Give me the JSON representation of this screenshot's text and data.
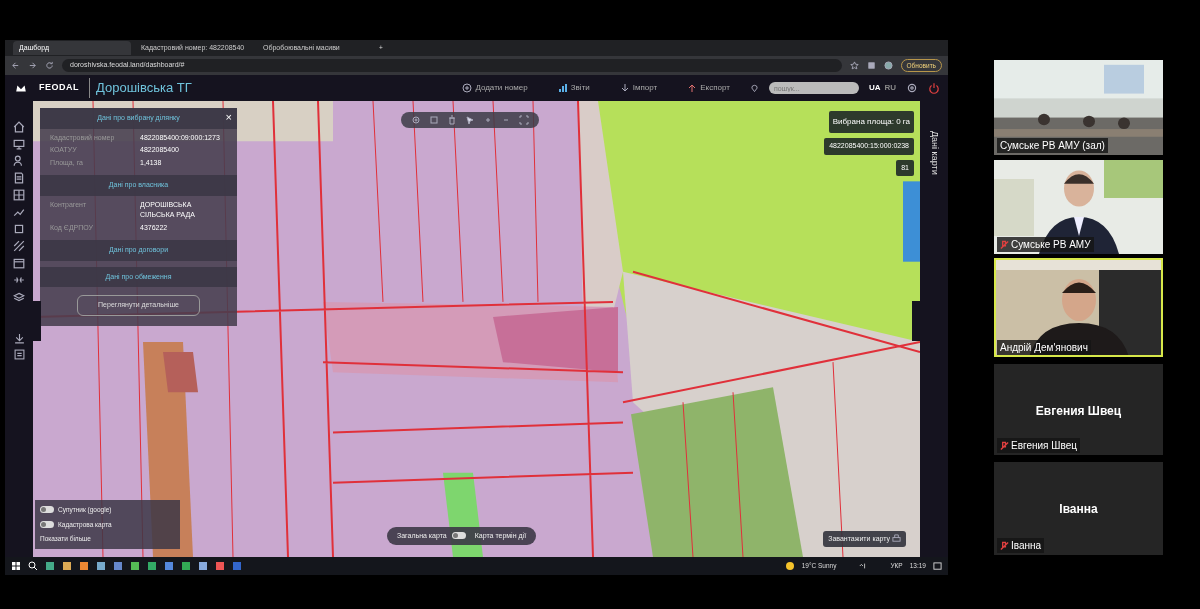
{
  "browser": {
    "tabs": [
      {
        "label": "Дашборд",
        "selected": true
      },
      {
        "label": "Кадастровий номер: 482208540",
        "selected": false
      },
      {
        "label": "Обробоювальні масиви",
        "selected": false
      }
    ],
    "new_tab": "+",
    "url": "doroshivska.feodal.land/dashboard/#",
    "update_button": "Обновить"
  },
  "app": {
    "brand": "FEODAL",
    "title": "Дорошівська ТГ",
    "actions": [
      {
        "label": "Додати номер"
      },
      {
        "label": "Звіти"
      },
      {
        "label": "Імпорт"
      },
      {
        "label": "Експорт"
      }
    ],
    "search_placeholder": "пошук...",
    "languages": [
      {
        "label": "UA",
        "selected": true
      },
      {
        "label": "RU",
        "selected": false
      }
    ]
  },
  "parcel_panel": {
    "title": "Дані про вибрану ділянку",
    "close": "×",
    "sections": [
      {
        "fields": [
          {
            "label": "Кадастровий номер",
            "value": "4822085400:09:000:1273"
          },
          {
            "label": "КОАТУУ",
            "value": "4822085400"
          },
          {
            "label": "Площа, га",
            "value": "1,4138"
          }
        ]
      },
      {
        "title": "Дані про власника",
        "fields": [
          {
            "label": "Контрагент",
            "value": "ДОРОШІВСЬКА СІЛЬСЬКА РАДА"
          },
          {
            "label": "Код ЄДРПОУ",
            "value": "4376222"
          }
        ]
      },
      {
        "title": "Дані про договори"
      },
      {
        "title": "Дані про обмеження"
      }
    ],
    "button": "Переглянути детальніше"
  },
  "selection_info": {
    "area": "Вибрана площа: 0 га",
    "parcel": "4822085400:15:000:0238",
    "count": "81"
  },
  "layers": [
    {
      "label": "Супутник (google)",
      "on": false
    },
    {
      "label": "Кадастрова карта",
      "on": false
    }
  ],
  "show_more": "Показати більше",
  "map_mode": {
    "left": "Загальна карта",
    "right": "Карта термін дії",
    "on": false
  },
  "download_button": "Завантажити карту",
  "side_panel_title": "Дані карти",
  "taskbar": {
    "weather": "19°C  Sunny",
    "lang": "УКР",
    "time": "13:19"
  },
  "participants": [
    {
      "kind": "video",
      "name": "Сумське РВ АМУ (зал)",
      "muted": false,
      "speaking": false
    },
    {
      "kind": "video",
      "name": "Сумське РВ АМУ",
      "muted": true,
      "speaking": false
    },
    {
      "kind": "video",
      "name": "Андрій Дем'янович",
      "muted": false,
      "speaking": true
    },
    {
      "kind": "avatar",
      "title": "Евгения Швец",
      "name": "Евгения Швец",
      "muted": true,
      "speaking": false
    },
    {
      "kind": "avatar",
      "title": "Іванна",
      "name": "Іванна",
      "muted": true,
      "speaking": false
    }
  ]
}
